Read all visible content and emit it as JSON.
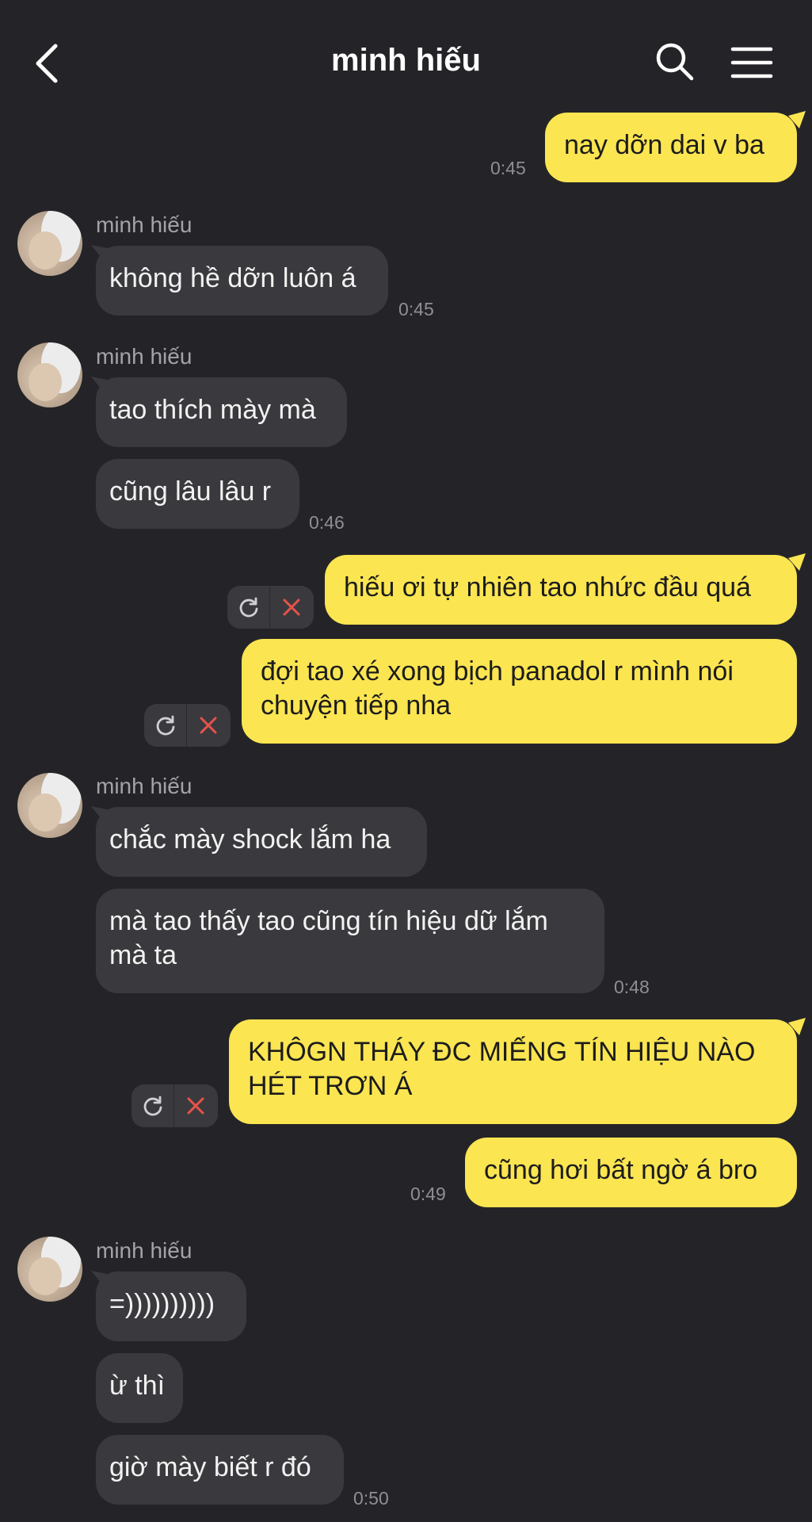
{
  "header": {
    "title": "minh hiếu"
  },
  "messages": {
    "m1": {
      "text": "nay dỡn dai v ba",
      "time": "0:45"
    },
    "g1": {
      "sender": "minh hiếu",
      "m1": "không hề dỡn luôn á",
      "time": "0:45"
    },
    "g2": {
      "sender": "minh hiếu",
      "m1": "tao thích mày mà",
      "m2": "cũng lâu lâu r",
      "time": "0:46"
    },
    "m2": {
      "text": "hiếu ơi tự nhiên tao nhức đầu quá"
    },
    "m3": {
      "text": "đợi tao xé xong bịch panadol r mình nói\nchuyện tiếp nha"
    },
    "g3": {
      "sender": "minh hiếu",
      "m1": "chắc mày shock lắm ha",
      "m2": "mà tao thấy tao cũng tín hiệu dữ lắm\nmà ta",
      "time": "0:48"
    },
    "m4": {
      "text": "KHÔGN THÁY ĐC MIẾNG TÍN HIỆU NÀO\nHÉT TRƠN Á"
    },
    "m5": {
      "text": "cũng hơi bất ngờ á bro",
      "time": "0:49"
    },
    "g4": {
      "sender": "minh hiếu",
      "m1": "=))))))))))",
      "m2": "ừ thì",
      "m3": "giờ mày biết r đó",
      "time": "0:50"
    }
  },
  "colors": {
    "background": "#242428",
    "incoming_bubble": "#3a3a3e",
    "outgoing_bubble": "#fbe551",
    "timestamp": "#8e8e93",
    "error_x": "#e5534b"
  },
  "icons": {
    "back": "chevron-left-icon",
    "search": "search-icon",
    "menu": "hamburger-menu-icon",
    "retry": "refresh-icon",
    "delete": "close-icon"
  }
}
